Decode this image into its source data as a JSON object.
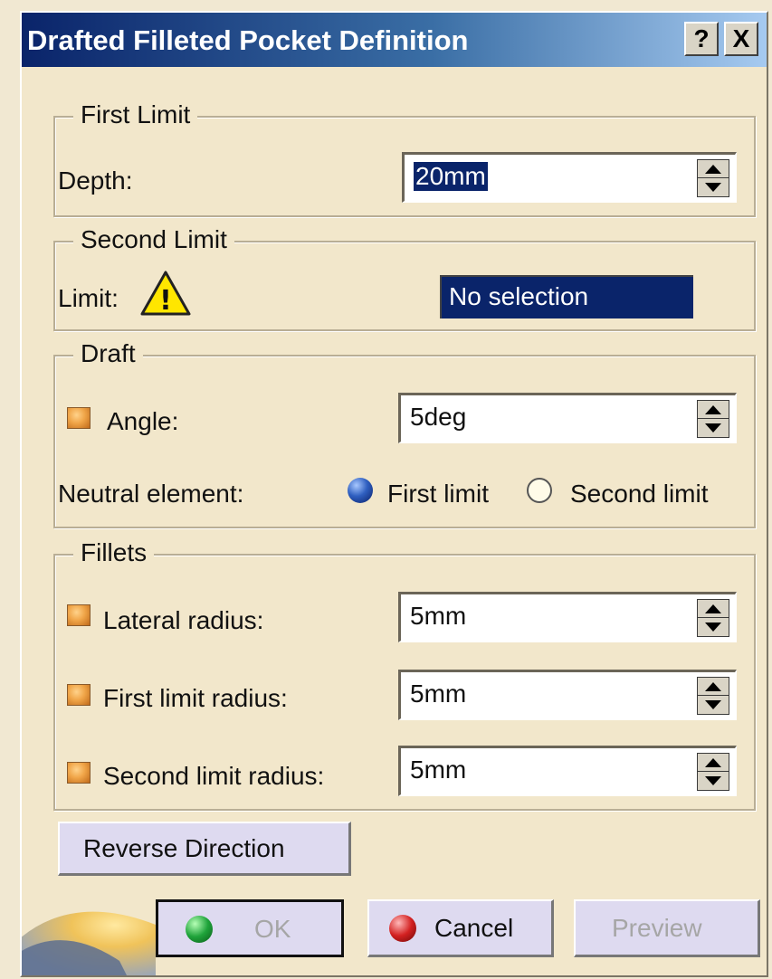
{
  "dialog": {
    "title": "Drafted Filleted Pocket Definition",
    "help_label": "?",
    "close_label": "X"
  },
  "first_limit": {
    "legend": "First Limit",
    "depth_label": "Depth:",
    "depth_value": "20mm"
  },
  "second_limit": {
    "legend": "Second Limit",
    "limit_label": "Limit:",
    "limit_value": "No selection",
    "warning_glyph": "!"
  },
  "draft": {
    "legend": "Draft",
    "angle_label": "Angle:",
    "angle_value": "5deg",
    "neutral_label": "Neutral element:",
    "options": [
      "First limit",
      "Second limit"
    ],
    "selected_option": "First limit"
  },
  "fillets": {
    "legend": "Fillets",
    "lateral_label": "Lateral radius:",
    "lateral_value": "5mm",
    "first_limit_label": "First limit radius:",
    "first_limit_value": "5mm",
    "second_limit_label": "Second limit radius:",
    "second_limit_value": "5mm"
  },
  "buttons": {
    "reverse": "Reverse Direction",
    "ok": "OK",
    "cancel": "Cancel",
    "preview": "Preview"
  },
  "colors": {
    "dialog_bg": "#f2e7cb",
    "title_start": "#0a246a",
    "title_end": "#a6caf0",
    "selection_bg": "#0a246a",
    "ok_ball": "#1fa33a",
    "cancel_ball": "#d32020"
  },
  "icons": {
    "warning": "warning-triangle-icon",
    "checkbox": "orange-checkbox-icon",
    "ok": "green-ball-icon",
    "cancel": "red-ball-icon"
  }
}
